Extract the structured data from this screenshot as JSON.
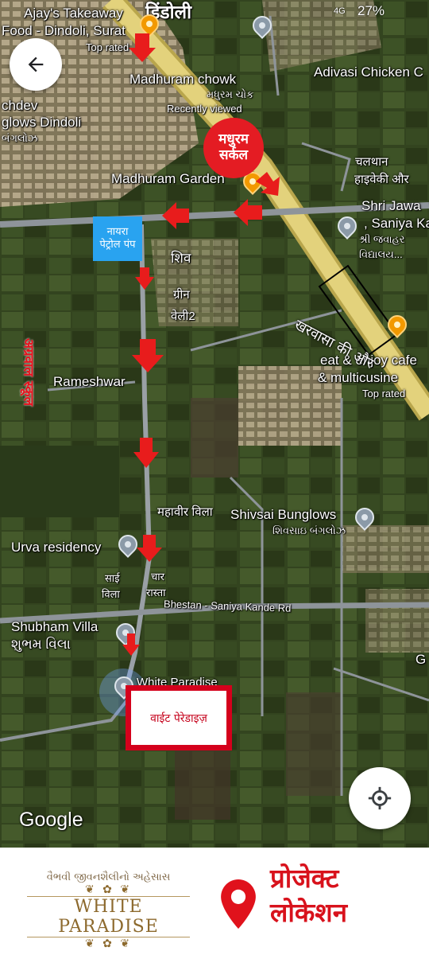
{
  "status_bar": {
    "battery": "27%",
    "network": "4G"
  },
  "map": {
    "labels": {
      "ajay": "Ajay's Takeaway",
      "food_dindoli": "Food - Dindoli, Surat",
      "top_rated_1": "Top rated",
      "dindoli_hi": "डिंडोली",
      "madhuram_chowk": "Madhuram chowk",
      "madhuram_chowk_gu": "મધુરમ ચોક",
      "recently_viewed": "Recently viewed",
      "adivasi": "Adivasi Chicken C",
      "chdev": "chdev",
      "glows_dindoli": "glows Dindoli",
      "bunglo_gu": "બંગલોઝ",
      "madhuram_garden": "Madhuram Garden",
      "chalthan": "चलथान",
      "highway": "हाइवेकी और",
      "shri_jawa": "Shri Jawa",
      "saniya_ka": ", Saniya Ka",
      "jawahar_gu": "શ્રી જવાહર",
      "vidyalay_gu": "વિદ્યાલય...",
      "shiv": "शिव",
      "green": "ग्रीन",
      "valley": "वेली2",
      "eat_enjoy": "eat & enjoy cafe",
      "multicusine": "& multicusine",
      "top_rated_2": "Top rated",
      "rameshwar": "Rameshwar",
      "mahavir": "महावीर विला",
      "shivsai": "Shivsai Bunglows",
      "shivsai_gu": "શિવસાઇ બંગલોઝ",
      "urva": "Urva residency",
      "sai": "साई",
      "villa": "विला",
      "char": "चार",
      "rasta": "रास्ता",
      "bhestan": "Bhestan - Saniya Kande Rd",
      "shubham": "Shubham Villa",
      "shubham_gu": "શુભમ વિલા",
      "white_paradise": "White Paradise",
      "g_edge": "G"
    },
    "annotations": {
      "madhuram_circle_line1": "मधुरम",
      "madhuram_circle_line2": "सर्कल",
      "nayara_line1": "नायरा",
      "nayara_line2": "पेट्रोल पंप",
      "agrawal_school": "अग्रवाल स्कूल",
      "kharwasa": "खरवासा की और",
      "white_paradise_hi": "वाईट पेरेडाइज़"
    },
    "attribution": "Google",
    "icons": [
      "back-arrow-icon",
      "my-location-icon",
      "place-pin-icon"
    ]
  },
  "footer": {
    "tagline": "વૈભવી જીવનશૈલીનો અહેસાસ",
    "brand_name": "WHITE PARADISE",
    "project_line1": "प्रोजेक्ट",
    "project_line2": "लोकेशन"
  },
  "colors": {
    "annotation_red": "#e41c23",
    "petrol_blue": "#29a3f0",
    "brand_gold": "#8d6a2e",
    "highway_yellow": "#d8c46a"
  }
}
